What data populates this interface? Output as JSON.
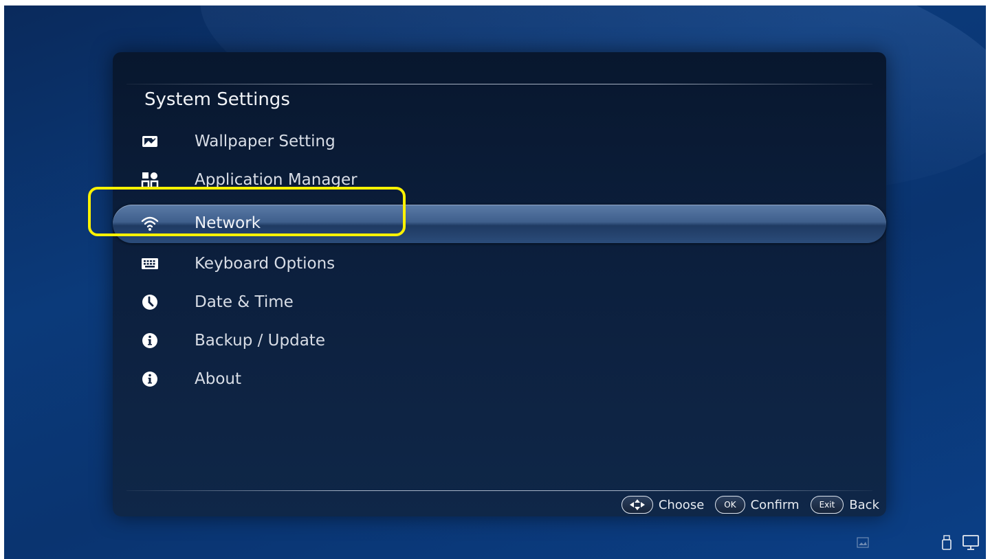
{
  "panel": {
    "title": "System Settings"
  },
  "menu": [
    {
      "icon": "wallpaper-icon",
      "label": "Wallpaper Setting",
      "selected": false
    },
    {
      "icon": "apps-grid-icon",
      "label": "Application Manager",
      "selected": false
    },
    {
      "icon": "wifi-icon",
      "label": "Network",
      "selected": true
    },
    {
      "icon": "keyboard-icon",
      "label": "Keyboard Options",
      "selected": false
    },
    {
      "icon": "clock-icon",
      "label": "Date & Time",
      "selected": false
    },
    {
      "icon": "info-icon",
      "label": "Backup / Update",
      "selected": false
    },
    {
      "icon": "info-icon",
      "label": "About",
      "selected": false
    }
  ],
  "hints": {
    "choose_label": "Choose",
    "ok_key": "OK",
    "confirm_label": "Confirm",
    "exit_key": "Exit",
    "back_label": "Back"
  },
  "status_icons": [
    "picture-icon",
    "usb-icon",
    "monitor-icon"
  ],
  "colors": {
    "highlight": "#fff200",
    "background": "#0b3a7a",
    "panel": "#0c1f3d",
    "text": "#d8dde6"
  }
}
